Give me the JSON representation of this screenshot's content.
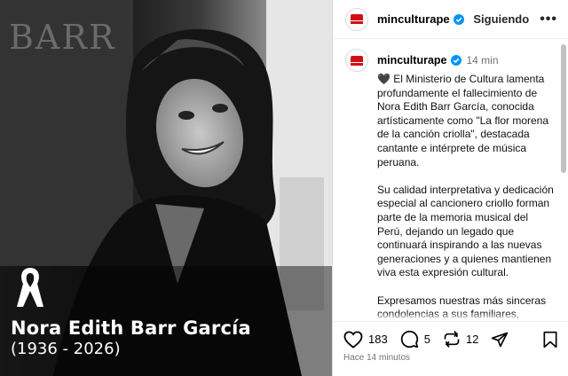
{
  "post": {
    "image": {
      "wall_text": "BARR",
      "overlay_name": "Nora Edith Barr García",
      "overlay_years": "(1936 - 2026)"
    },
    "header": {
      "username": "minculturape",
      "follow_state": "Siguiendo",
      "more_label": "•••"
    },
    "caption": {
      "username": "minculturape",
      "time": "14 min",
      "paragraphs": [
        "🖤 El Ministerio de Cultura lamenta profundamente el fallecimiento de Nora Edith Barr García, conocida artísticamente como \"La flor morena de la canción criolla\", destacada cantante e intérprete de música peruana.",
        "Su calidad interpretativa y dedicación especial al cancionero criollo forman parte de la memoria musical del Perú, dejando un legado que continuará inspirando a las nuevas generaciones y a quienes mantienen viva esta expresión cultural.",
        "Expresamos nuestras más sinceras condolencias a sus familiares, amistades, colegas y a toda la comunidad artística y cultural que hoy despide a una de sus más queridas representantes."
      ]
    },
    "actions": {
      "likes": "183",
      "comments": "5",
      "reposts": "12"
    },
    "timestamp": "Hace 14 minutos",
    "icons": {
      "like": "heart-icon",
      "comment": "comment-icon",
      "repost": "repost-icon",
      "share": "share-icon",
      "save": "bookmark-icon",
      "verified": "verified-badge-icon",
      "mourning": "mourning-ribbon-icon"
    },
    "colors": {
      "verified_blue": "#0095f6",
      "brand_red": "#d40f14",
      "muted_text": "#737373"
    }
  }
}
